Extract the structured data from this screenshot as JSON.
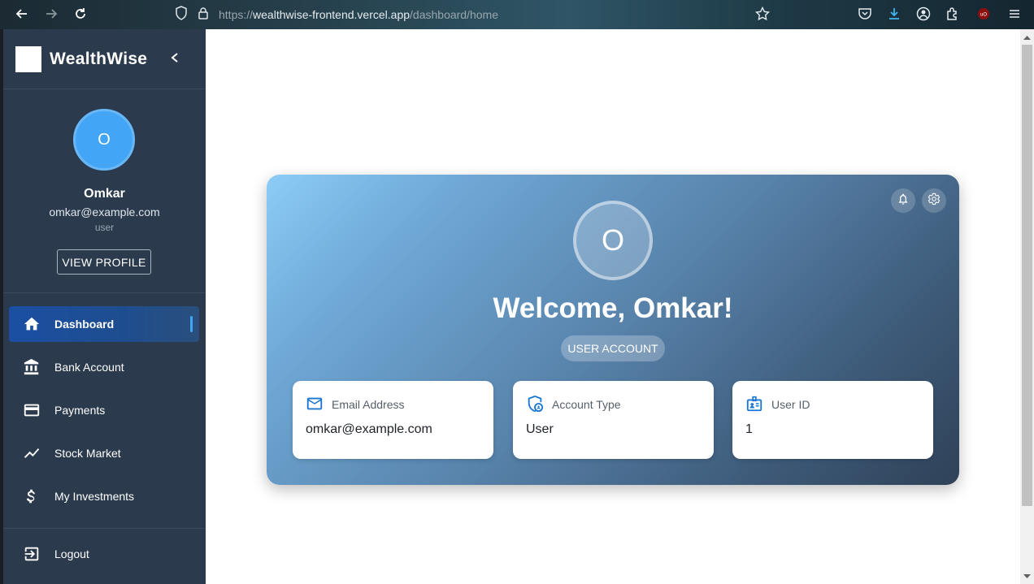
{
  "browser": {
    "url_prefix": "https://",
    "url_host": "wealthwise-frontend.vercel.app",
    "url_path": "/dashboard/home"
  },
  "sidebar": {
    "brand": "WealthWise",
    "profile": {
      "avatar_initial": "O",
      "name": "Omkar",
      "email": "omkar@example.com",
      "role": "user",
      "view_profile_label": "VIEW PROFILE"
    },
    "items": [
      {
        "label": "Dashboard",
        "icon": "home-icon",
        "active": true
      },
      {
        "label": "Bank Account",
        "icon": "bank-icon",
        "active": false
      },
      {
        "label": "Payments",
        "icon": "credit-card-icon",
        "active": false
      },
      {
        "label": "Stock Market",
        "icon": "trending-icon",
        "active": false
      },
      {
        "label": "My Investments",
        "icon": "dollar-icon",
        "active": false
      }
    ],
    "logout_label": "Logout"
  },
  "main": {
    "avatar_initial": "O",
    "welcome": "Welcome, Omkar!",
    "account_chip": "USER ACCOUNT",
    "info_cards": [
      {
        "label": "Email Address",
        "value": "omkar@example.com",
        "icon": "mail-icon"
      },
      {
        "label": "Account Type",
        "value": "User",
        "icon": "shield-account-icon"
      },
      {
        "label": "User ID",
        "value": "1",
        "icon": "badge-icon"
      }
    ]
  },
  "colors": {
    "sidebar_bg": "#2b3a4d",
    "accent": "#42a5f5",
    "active_nav": "#1a4fa3",
    "info_icon": "#1976d2"
  }
}
